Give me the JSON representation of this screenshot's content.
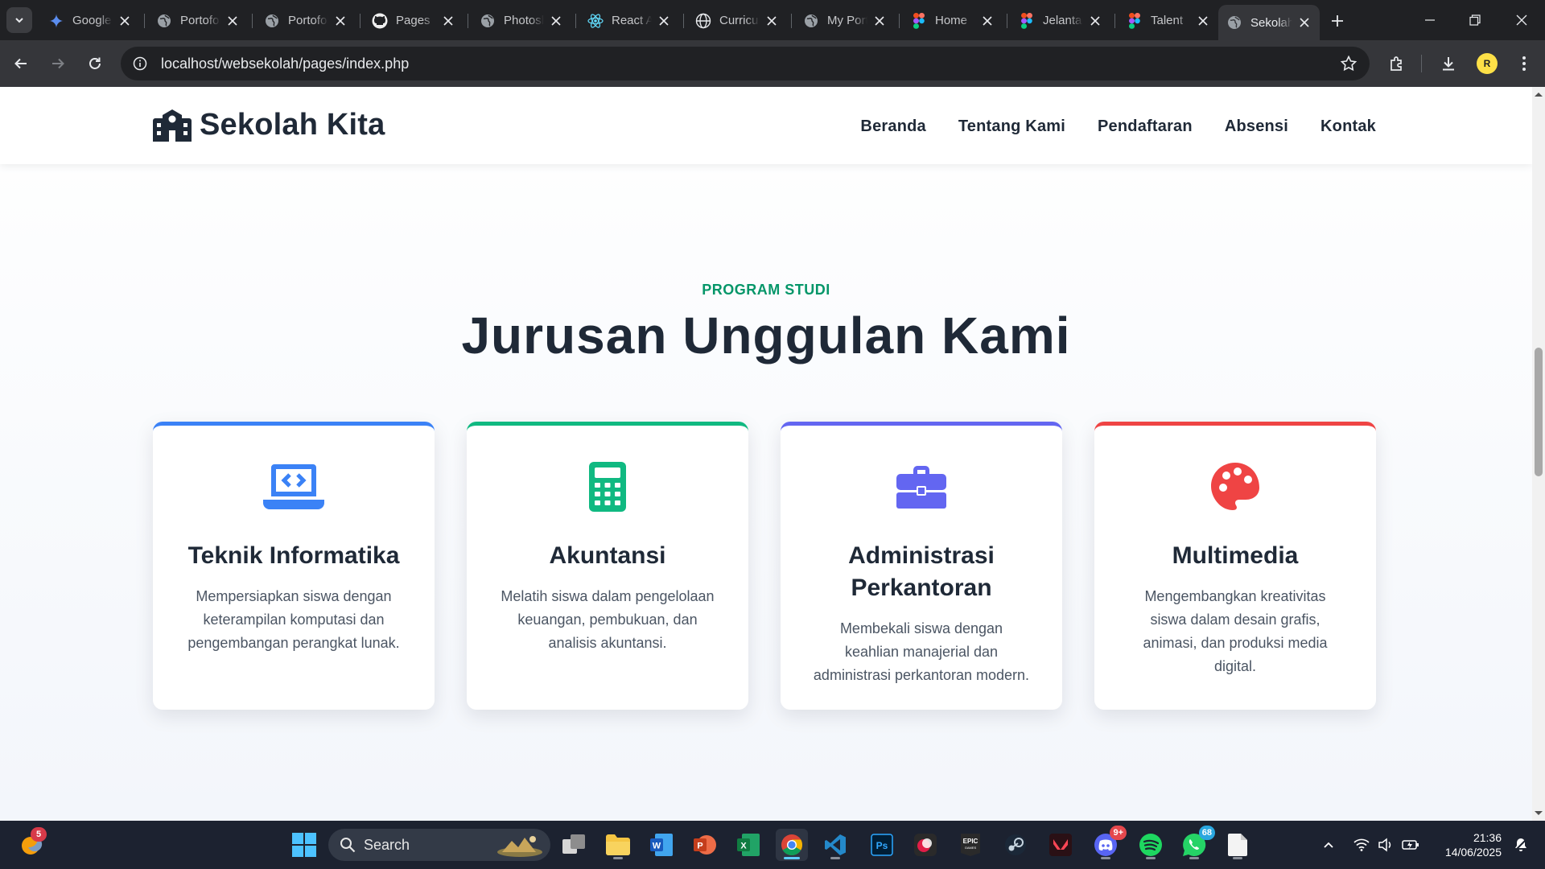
{
  "browser": {
    "tabs": [
      {
        "title": "Google",
        "icon": "gemini-icon"
      },
      {
        "title": "Portofolio",
        "icon": "globe-icon"
      },
      {
        "title": "Portofolio",
        "icon": "globe-icon"
      },
      {
        "title": "Pages",
        "icon": "github-icon"
      },
      {
        "title": "Photoshop",
        "icon": "globe-icon"
      },
      {
        "title": "React App",
        "icon": "react-icon"
      },
      {
        "title": "Curriculum",
        "icon": "web-icon"
      },
      {
        "title": "My Portfolio",
        "icon": "globe-icon"
      },
      {
        "title": "Home",
        "icon": "figma-icon"
      },
      {
        "title": "Jelantara",
        "icon": "figma-icon"
      },
      {
        "title": "Talent",
        "icon": "figma-icon"
      },
      {
        "title": "Sekolah Kita",
        "icon": "globe-icon",
        "active": true
      }
    ],
    "url": "localhost/websekolah/pages/index.php",
    "profile_initial": "R"
  },
  "site": {
    "brand": "Sekolah Kita",
    "menu": [
      "Beranda",
      "Tentang Kami",
      "Pendaftaran",
      "Absensi",
      "Kontak"
    ],
    "section": {
      "eyebrow": "PROGRAM STUDI",
      "heading": "Jurusan Unggulan Kami",
      "cards": [
        {
          "title": "Teknik Informatika",
          "text": "Mempersiapkan siswa dengan keterampilan komputasi dan pengembangan perangkat lunak.",
          "icon": "laptop-code-icon",
          "color": "#3b82f6"
        },
        {
          "title": "Akuntansi",
          "text": "Melatih siswa dalam pengelolaan keuangan, pembukuan, dan analisis akuntansi.",
          "icon": "calculator-icon",
          "color": "#10b981"
        },
        {
          "title": "Administrasi Perkantoran",
          "text": "Membekali siswa dengan keahlian manajerial dan administrasi perkantoran modern.",
          "icon": "briefcase-icon",
          "color": "#6366f1"
        },
        {
          "title": "Multimedia",
          "text": "Mengembangkan kreativitas siswa dalam desain grafis, animasi, dan produksi media digital.",
          "icon": "palette-icon",
          "color": "#ef4444"
        }
      ]
    }
  },
  "taskbar": {
    "search_placeholder": "Search",
    "widget_badge": "5",
    "discord_badge": "9+",
    "whatsapp_badge": "68",
    "time": "21:36",
    "date": "14/06/2025"
  }
}
